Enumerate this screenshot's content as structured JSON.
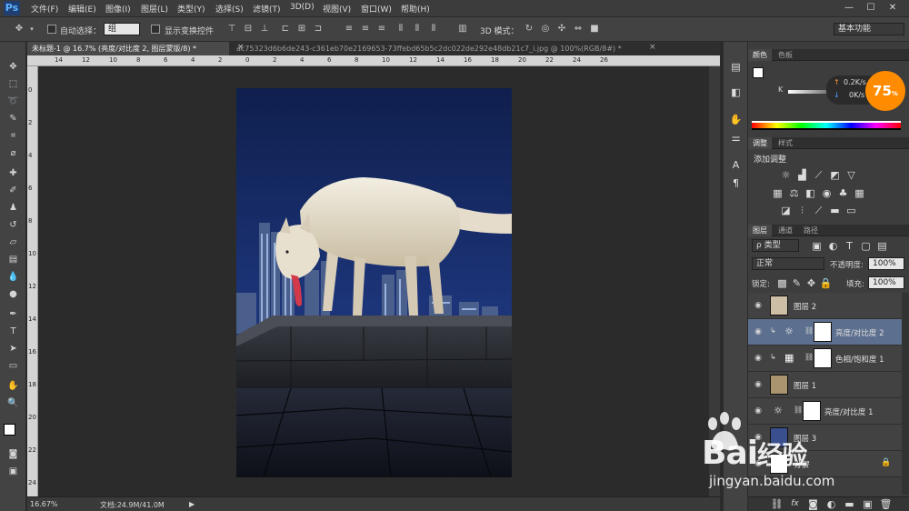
{
  "app": {
    "logo": "Ps"
  },
  "menu": [
    "文件(F)",
    "编辑(E)",
    "图像(I)",
    "图层(L)",
    "类型(Y)",
    "选择(S)",
    "滤镜(T)",
    "3D(D)",
    "视图(V)",
    "窗口(W)",
    "帮助(H)"
  ],
  "window": {
    "minimize": "—",
    "maximize": "☐",
    "close": "✕"
  },
  "options": {
    "auto_select_label": "自动选择：",
    "auto_select_value": "组",
    "show_transform_label": "显示变换控件",
    "mode3d_label": "3D 模式：",
    "workspace": "基本功能"
  },
  "tabs": [
    {
      "label": "未标题-1 @ 16.7% (亮度/对比度 2, 图层蒙版/8) *",
      "close": "×"
    },
    {
      "label": "ac75323d6b6de243-c361eb70e2169653-73ffebd65b5c2dc022de292e48db21c7_i.jpg @ 100%(RGB/8#) *",
      "close": "×"
    }
  ],
  "ruler": {
    "h": [
      "14",
      "12",
      "10",
      "8",
      "6",
      "4",
      "2",
      "0",
      "2",
      "4",
      "6",
      "8",
      "10",
      "12",
      "14",
      "16",
      "18",
      "20",
      "22",
      "24",
      "26"
    ],
    "v": [
      "0",
      "2",
      "4",
      "6",
      "8",
      "10",
      "12",
      "14",
      "16",
      "18",
      "20",
      "22",
      "24"
    ]
  },
  "status": {
    "zoom": "16.67%",
    "doc": "文档:24.9M/41.0M",
    "arrow": "▶"
  },
  "color_panel": {
    "tabs": [
      "颜色",
      "色板"
    ],
    "channel": "K",
    "upload_speed": "0.2K/s",
    "download_speed": "0K/s",
    "cpu": "75",
    "cpu_unit": "%"
  },
  "adjust_panel": {
    "tabs": [
      "调整",
      "样式"
    ],
    "title": "添加调整"
  },
  "layers_panel": {
    "tabs": [
      "图层",
      "通道",
      "路径"
    ],
    "filter": "ρ 类型",
    "blend": "正常",
    "opacity_label": "不透明度:",
    "opacity": "100%",
    "lock_label": "锁定:",
    "fill_label": "填充:",
    "fill": "100%",
    "layers": [
      {
        "name": "图层 2"
      },
      {
        "name": "亮度/对比度 2"
      },
      {
        "name": "色相/饱和度 1"
      },
      {
        "name": "图层 1"
      },
      {
        "name": "亮度/对比度 1"
      },
      {
        "name": "图层 3"
      },
      {
        "name": "背景"
      }
    ]
  },
  "watermark": {
    "brand": "Bai",
    "brand2": "经验",
    "url": "jingyan.baidu.com"
  },
  "colors": {
    "accent": "#ff8c00",
    "selected_layer": "#5d6f8e",
    "sky": "#14285a"
  }
}
